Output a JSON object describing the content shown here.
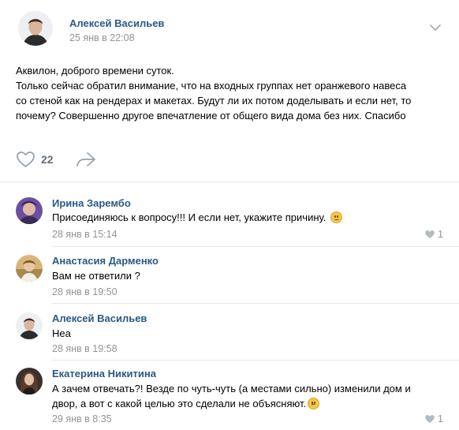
{
  "post": {
    "author": "Алексей Васильев",
    "date": "25 янв в 22:08",
    "lines": [
      "Аквилон, доброго времени суток.",
      "Только сейчас обратил внимание, что на входных группах нет оранжевого навеса",
      "со стеной как на рендерах и макетах. Будут ли их потом доделывать и если нет, то",
      "почему? Совершенно другое впечатление от общего вида дома без них. Спасибо"
    ],
    "like_count": "22",
    "icons": {
      "menu": "chevron-down-icon",
      "like": "heart-icon",
      "share": "share-arrow-icon"
    }
  },
  "comments": [
    {
      "author": "Ирина Зарембо",
      "lines": [
        "Присоединяюсь к вопросу!!! И если нет, укажите причину."
      ],
      "emoji": "sad-face-emoji",
      "date": "28 янв в 15:14",
      "likes": "1"
    },
    {
      "author": "Анастасия Дарменко",
      "lines": [
        "Вам не ответили ?"
      ],
      "date": "28 янв в 19:50"
    },
    {
      "author": "Алексей Васильев",
      "lines": [
        "Неа"
      ],
      "date": "28 янв в 19:58"
    },
    {
      "author": "Екатерина Никитина",
      "lines": [
        "А зачем отвечать?! Везде по чуть-чуть (а местами сильно) изменили дом и",
        "двор, а вот с какой целью это сделали не объясняют."
      ],
      "emoji": "confused-face-emoji",
      "date": "29 янв в 8:35",
      "likes": "1"
    }
  ],
  "colors": {
    "name": "#2a5885",
    "meta": "#939393",
    "divider": "#e7e8ec",
    "icon": "#99a2ad"
  }
}
